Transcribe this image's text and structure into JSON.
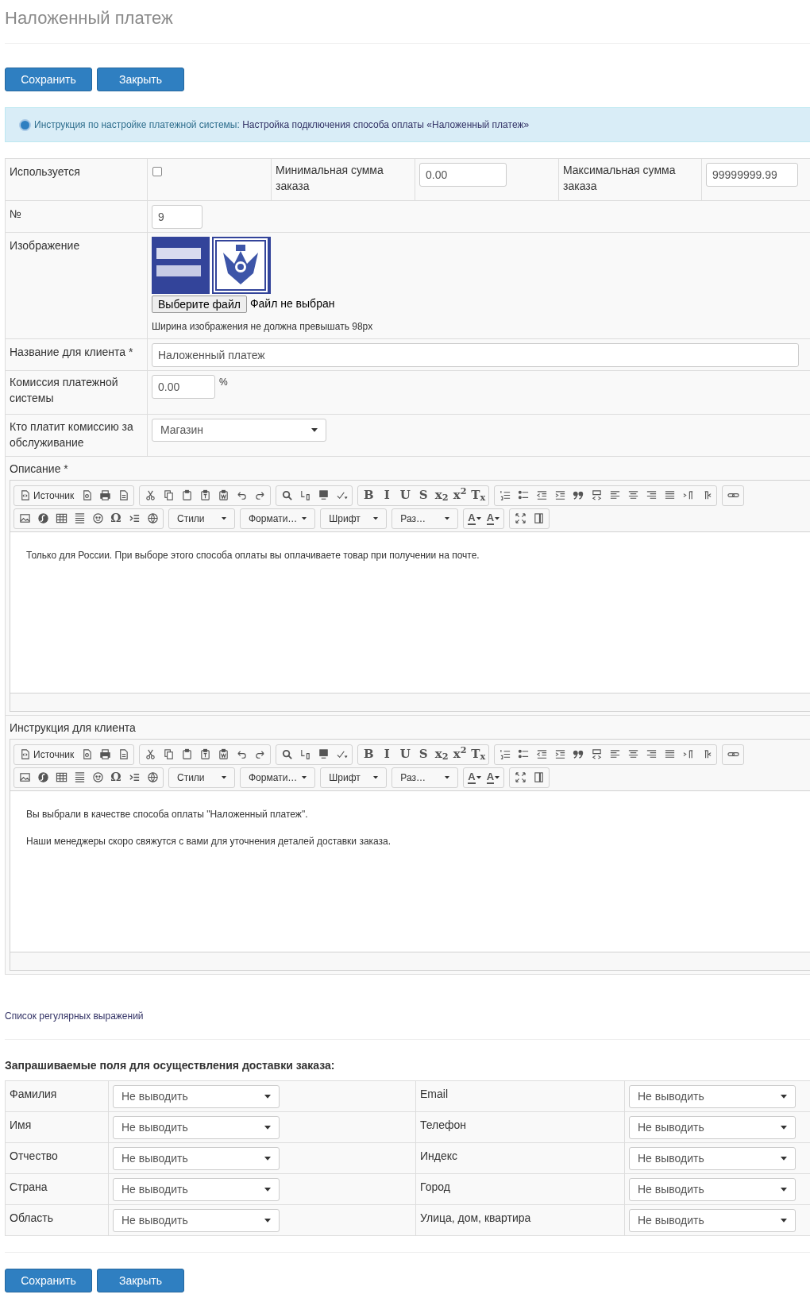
{
  "title": "Наложенный платеж",
  "top_buttons": [
    "Сохранить",
    "Закрыть"
  ],
  "info": {
    "prefix": "Инструкция по настройке платежной системы:",
    "link": "Настройка подключения способа оплаты «Наложенный платеж»"
  },
  "settings": {
    "enabled": {
      "label": "Используется",
      "checked": false
    },
    "min_order": {
      "label": "Минимальная сумма заказа",
      "value": "0.00"
    },
    "max_order": {
      "label": "Максимальная сумма заказа",
      "value": "99999999.99"
    },
    "number": {
      "label": "№",
      "value": "9"
    },
    "image": {
      "label": "Изображение",
      "file_button": "Выберите файл",
      "file_status": "Файл не выбран",
      "hint": "Ширина изображения не должна превышать 98px"
    },
    "client_name": {
      "label": "Название для клиента *",
      "value": "Наложенный платеж"
    },
    "commission": {
      "label": "Комиссия платежной системы",
      "value": "0.00",
      "unit": "%"
    },
    "commission_payer": {
      "label": "Кто платит комиссию за обслуживание",
      "value": "Магазин"
    }
  },
  "editors": [
    {
      "label": "Описание *",
      "toolbar": [
        [
          [
            {
              "kind": "source",
              "label": "Источник"
            },
            {
              "kind": "icon"
            },
            {
              "kind": "icon"
            },
            {
              "kind": "icon"
            }
          ],
          [
            {
              "kind": "icon"
            },
            {
              "kind": "icon"
            },
            {
              "kind": "icon"
            },
            {
              "kind": "icon"
            },
            {
              "kind": "icon"
            },
            {
              "kind": "icon"
            },
            {
              "kind": "icon"
            }
          ],
          [
            {
              "kind": "icon"
            },
            {
              "kind": "icon"
            },
            {
              "kind": "icon"
            },
            {
              "kind": "icon"
            }
          ],
          [
            {
              "kind": "glyph",
              "text": "B"
            },
            {
              "kind": "glyph",
              "text": "I"
            },
            {
              "kind": "glyph",
              "text": "U"
            },
            {
              "kind": "glyph",
              "text": "S"
            },
            {
              "kind": "glyph",
              "text": "x$_{2}$"
            },
            {
              "kind": "glyph",
              "text": "x$^{2}$"
            },
            {
              "kind": "glyph",
              "text": "T$_{x}$"
            }
          ],
          [
            {
              "kind": "icon"
            },
            {
              "kind": "icon"
            },
            {
              "kind": "icon"
            },
            {
              "kind": "icon"
            },
            {
              "kind": "icon"
            },
            {
              "kind": "icon"
            },
            {
              "kind": "icon"
            },
            {
              "kind": "icon"
            },
            {
              "kind": "icon"
            },
            {
              "kind": "icon"
            },
            {
              "kind": "icon"
            },
            {
              "kind": "icon"
            }
          ],
          [
            {
              "kind": "icon"
            }
          ]
        ],
        [
          [
            {
              "kind": "icon"
            },
            {
              "kind": "icon"
            },
            {
              "kind": "icon"
            },
            {
              "kind": "icon"
            },
            {
              "kind": "icon"
            },
            {
              "kind": "glyph",
              "text": "Ω"
            },
            {
              "kind": "icon"
            },
            {
              "kind": "icon"
            }
          ],
          [
            {
              "kind": "combo",
              "label": "Стили"
            }
          ],
          [
            {
              "kind": "combo",
              "label": "Формати…"
            }
          ],
          [
            {
              "kind": "combo",
              "label": "Шрифт"
            }
          ],
          [
            {
              "kind": "combo",
              "label": "Раз…"
            }
          ],
          [
            {
              "kind": "color",
              "text": "A"
            },
            {
              "kind": "color",
              "text": "A"
            }
          ],
          [
            {
              "kind": "icon"
            },
            {
              "kind": "icon"
            }
          ]
        ]
      ],
      "paragraphs": [
        "Только для России. При выборе этого способа оплаты вы оплачиваете товар при получении на почте."
      ]
    },
    {
      "label": "Инструкция для клиента",
      "toolbar": [
        [
          [
            {
              "kind": "source",
              "label": "Источник"
            },
            {
              "kind": "icon"
            },
            {
              "kind": "icon"
            },
            {
              "kind": "icon"
            }
          ],
          [
            {
              "kind": "icon"
            },
            {
              "kind": "icon"
            },
            {
              "kind": "icon"
            },
            {
              "kind": "icon"
            },
            {
              "kind": "icon"
            },
            {
              "kind": "icon"
            },
            {
              "kind": "icon"
            }
          ],
          [
            {
              "kind": "icon"
            },
            {
              "kind": "icon"
            },
            {
              "kind": "icon"
            },
            {
              "kind": "icon"
            }
          ],
          [
            {
              "kind": "glyph",
              "text": "B"
            },
            {
              "kind": "glyph",
              "text": "I"
            },
            {
              "kind": "glyph",
              "text": "U"
            },
            {
              "kind": "glyph",
              "text": "S"
            },
            {
              "kind": "glyph",
              "text": "x$_{2}$"
            },
            {
              "kind": "glyph",
              "text": "x$^{2}$"
            },
            {
              "kind": "glyph",
              "text": "T$_{x}$"
            }
          ],
          [
            {
              "kind": "icon"
            },
            {
              "kind": "icon"
            },
            {
              "kind": "icon"
            },
            {
              "kind": "icon"
            },
            {
              "kind": "icon"
            },
            {
              "kind": "icon"
            },
            {
              "kind": "icon"
            },
            {
              "kind": "icon"
            },
            {
              "kind": "icon"
            },
            {
              "kind": "icon"
            },
            {
              "kind": "icon"
            },
            {
              "kind": "icon"
            }
          ],
          [
            {
              "kind": "icon"
            }
          ]
        ],
        [
          [
            {
              "kind": "icon"
            },
            {
              "kind": "icon"
            },
            {
              "kind": "icon"
            },
            {
              "kind": "icon"
            },
            {
              "kind": "icon"
            },
            {
              "kind": "glyph",
              "text": "Ω"
            },
            {
              "kind": "icon"
            },
            {
              "kind": "icon"
            }
          ],
          [
            {
              "kind": "combo",
              "label": "Стили"
            }
          ],
          [
            {
              "kind": "combo",
              "label": "Формати…"
            }
          ],
          [
            {
              "kind": "combo",
              "label": "Шрифт"
            }
          ],
          [
            {
              "kind": "combo",
              "label": "Раз…"
            }
          ],
          [
            {
              "kind": "color",
              "text": "A"
            },
            {
              "kind": "color",
              "text": "A"
            }
          ],
          [
            {
              "kind": "icon"
            },
            {
              "kind": "icon"
            }
          ]
        ]
      ],
      "paragraphs": [
        "Вы выбрали в качестве способа оплаты \"Наложенный платеж\".",
        "Наши менеджеры скоро свяжутся с вами для уточнения деталей доставки заказа."
      ]
    }
  ],
  "regex_link": "Список регулярных выражений",
  "delivery": {
    "heading": "Запрашиваемые поля для осуществления доставки заказа:",
    "rows": [
      [
        {
          "label": "Фамилия",
          "value": "Не выводить"
        },
        {
          "label": "Email",
          "value": "Не выводить"
        }
      ],
      [
        {
          "label": "Имя",
          "value": "Не выводить"
        },
        {
          "label": "Телефон",
          "value": "Не выводить"
        }
      ],
      [
        {
          "label": "Отчество",
          "value": "Не выводить"
        },
        {
          "label": "Индекс",
          "value": "Не выводить"
        }
      ],
      [
        {
          "label": "Страна",
          "value": "Не выводить"
        },
        {
          "label": "Город",
          "value": "Не выводить"
        }
      ],
      [
        {
          "label": "Область",
          "value": "Не выводить"
        },
        {
          "label": "Улица, дом, квартира",
          "value": "Не выводить"
        }
      ]
    ]
  },
  "bottom_buttons": [
    "Сохранить",
    "Закрыть"
  ]
}
